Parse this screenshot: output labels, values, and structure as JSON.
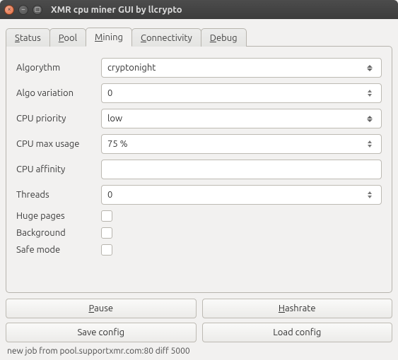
{
  "window": {
    "title": "XMR cpu miner GUI by llcrypto"
  },
  "tabs": [
    {
      "label": "Status"
    },
    {
      "label": "Pool"
    },
    {
      "label": "Mining",
      "active": true
    },
    {
      "label": "Connectivity"
    },
    {
      "label": "Debug"
    }
  ],
  "form": {
    "algorythm": {
      "label": "Algorythm",
      "value": "cryptonight"
    },
    "algo_variation": {
      "label": "Algo variation",
      "value": "0"
    },
    "cpu_priority": {
      "label": "CPU priority",
      "value": "low"
    },
    "cpu_max_usage": {
      "label": "CPU max usage",
      "value": "75 %"
    },
    "cpu_affinity": {
      "label": "CPU affinity",
      "value": ""
    },
    "threads": {
      "label": "Threads",
      "value": "0"
    },
    "huge_pages": {
      "label": "Huge pages",
      "checked": false
    },
    "background": {
      "label": "Background",
      "checked": false
    },
    "safe_mode": {
      "label": "Safe mode",
      "checked": false
    }
  },
  "buttons": {
    "pause": "Pause",
    "hashrate": "Hashrate",
    "save_config": "Save config",
    "load_config": "Load config"
  },
  "status_line": "new job from pool.supportxmr.com:80 diff 5000"
}
